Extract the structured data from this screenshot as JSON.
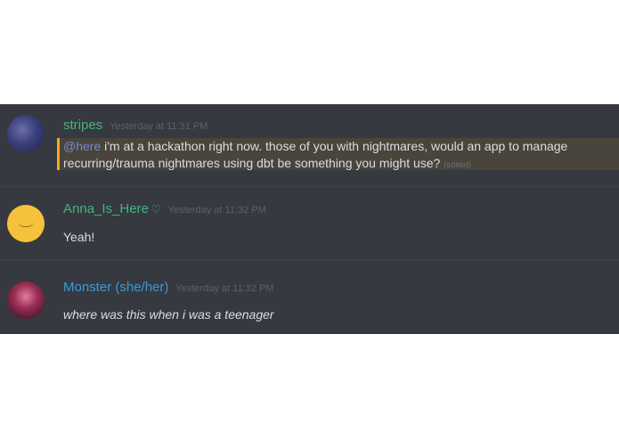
{
  "messages": [
    {
      "username": "stripes",
      "timestamp": "Yesterday at 11:31 PM",
      "mention": "@here",
      "text": " i'm at a hackathon right now. those of you with nightmares, would an app to manage recurring/trauma nightmares using dbt be something you might use?",
      "edited": "(edited)",
      "username_color": "#43b581",
      "highlight_color": "#faa61a"
    },
    {
      "username": "Anna_Is_Here",
      "badge_icon": "heart-icon",
      "timestamp": "Yesterday at 11:32 PM",
      "text": "Yeah!",
      "username_color": "#43b581"
    },
    {
      "username": "Monster (she/her)",
      "timestamp": "Yesterday at 11:32 PM",
      "text": "where was this when i was a teenager",
      "username_color": "#3a9ad9"
    }
  ],
  "background_color": "#36393f"
}
